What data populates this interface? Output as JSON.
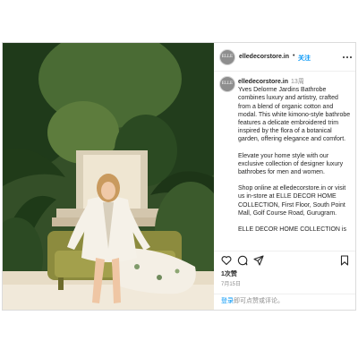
{
  "post": {
    "username": "elledecorstore.in",
    "dot": "•",
    "follow_label": "关注",
    "avatar_text": "ELLE",
    "caption": {
      "username": "elledecorstore.in",
      "time": "13周",
      "paragraphs": [
        "Yves Delorme Jardins Bathrobe combines luxury and artistry, crafted from a blend of organic cotton and modal. This white kimono-style bathrobe features a delicate embroidered trim inspired by the flora of a botanical garden, offering elegance and comfort.",
        "Elevate your home style with our exclusive collection of designer luxury bathrobes for men and women.",
        "Shop online at elledecorstore.in or visit us in-store at ELLE DECOR HOME COLLECTION, First Floor, South Point Mall, Golf Course Road, Gurugram.",
        "ELLE DECOR HOME COLLECTION is"
      ]
    },
    "likes": "1次赞",
    "date": "7月15日",
    "login_link": "登录",
    "login_rest": "即可点赞或评论。"
  },
  "icons": {
    "like": "heart-icon",
    "comment": "comment-icon",
    "share": "share-icon",
    "save": "bookmark-icon",
    "more": "more-icon"
  },
  "colors": {
    "accent": "#0095f6",
    "text": "#262626",
    "muted": "#8e8e8e",
    "border": "#dbdbdb"
  }
}
